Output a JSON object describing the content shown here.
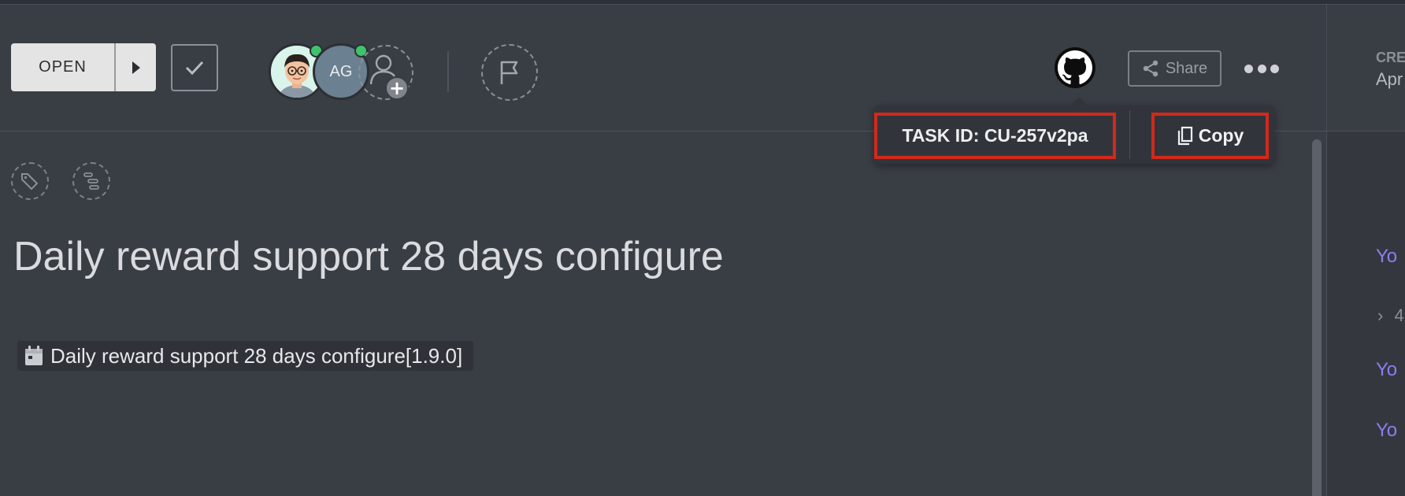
{
  "colors": {
    "background": "#393d44",
    "accent_highlight": "#d1291c",
    "online": "#3fc36a",
    "link_purple": "#8e7cf2"
  },
  "header": {
    "status_label": "OPEN",
    "assignees": [
      {
        "type": "photo",
        "online": true
      },
      {
        "type": "initials",
        "initials": "AG",
        "online": true
      }
    ],
    "share_label": "Share"
  },
  "popover": {
    "task_id_label": "TASK ID: CU-257v2pa",
    "copy_label": "Copy"
  },
  "task": {
    "title": "Daily reward support 28 days configure",
    "release_chip": "Daily reward support 28 days configure[1.9.0]"
  },
  "right_panel": {
    "created_label": "CRE",
    "created_date": "Apr",
    "activity_items": [
      "Yo",
      "Yo",
      "Yo"
    ],
    "collapsed_item": "4"
  },
  "icons": [
    "chevron-right-icon",
    "checkmark-icon",
    "add-user-icon",
    "flag-icon",
    "github-icon",
    "share-icon",
    "more-icon",
    "copy-icon",
    "tag-icon",
    "subtask-icon",
    "calendar-icon"
  ]
}
